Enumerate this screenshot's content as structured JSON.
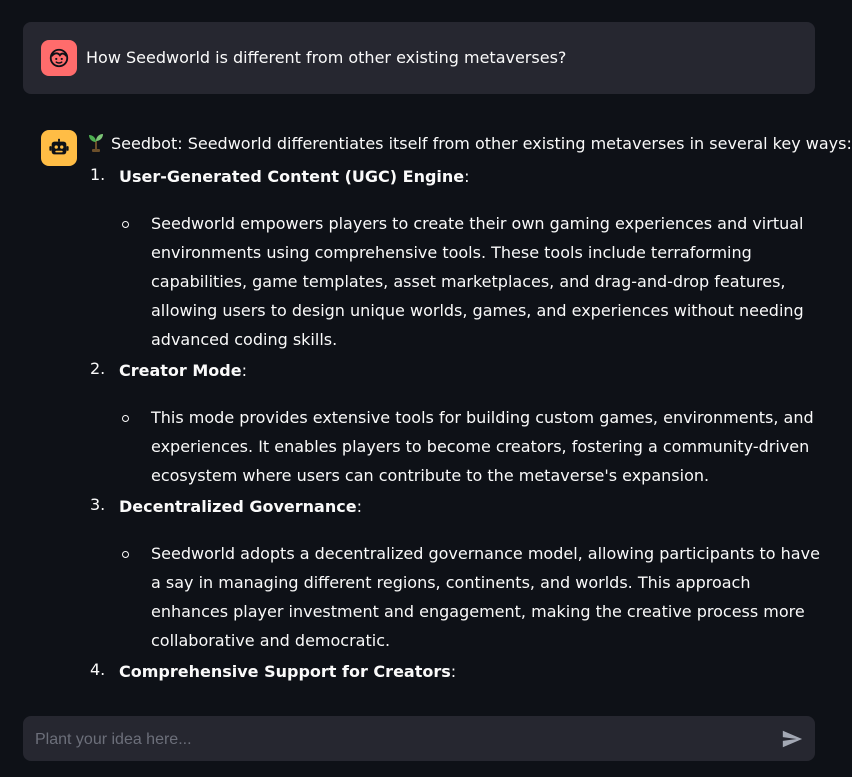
{
  "user_message": {
    "avatar_icon": "user-face-icon",
    "avatar_color": "#ff6c6c",
    "text": "How Seedworld is different from other existing metaverses?"
  },
  "bot_message": {
    "avatar_icon": "robot-face-icon",
    "avatar_color": "#ffbd45",
    "prefix_icon": "seedling-icon",
    "intro": "Seedbot: Seedworld differentiates itself from other existing metaverses in several key ways:",
    "points": [
      {
        "number": "1.",
        "title": "User-Generated Content (UGC) Engine",
        "suffix": ":",
        "detail": "Seedworld empowers players to create their own gaming experiences and virtual environments using comprehensive tools. These tools include terraforming capabilities, game templates, asset marketplaces, and drag-and-drop features, allowing users to design unique worlds, games, and experiences without needing advanced coding skills."
      },
      {
        "number": "2.",
        "title": "Creator Mode",
        "suffix": ":",
        "detail": "This mode provides extensive tools for building custom games, environments, and experiences. It enables players to become creators, fostering a community-driven ecosystem where users can contribute to the metaverse's expansion."
      },
      {
        "number": "3.",
        "title": "Decentralized Governance",
        "suffix": ":",
        "detail": "Seedworld adopts a decentralized governance model, allowing participants to have a say in managing different regions, continents, and worlds. This approach enhances player investment and engagement, making the creative process more collaborative and democratic."
      },
      {
        "number": "4.",
        "title": "Comprehensive Support for Creators",
        "suffix": ":"
      }
    ]
  },
  "chat_input": {
    "placeholder": "Plant your idea here...",
    "value": "",
    "send_icon": "send-icon"
  },
  "colors": {
    "background": "#0e1117",
    "panel": "#262730",
    "text": "#fafafa",
    "placeholder": "#6c6f7a"
  }
}
